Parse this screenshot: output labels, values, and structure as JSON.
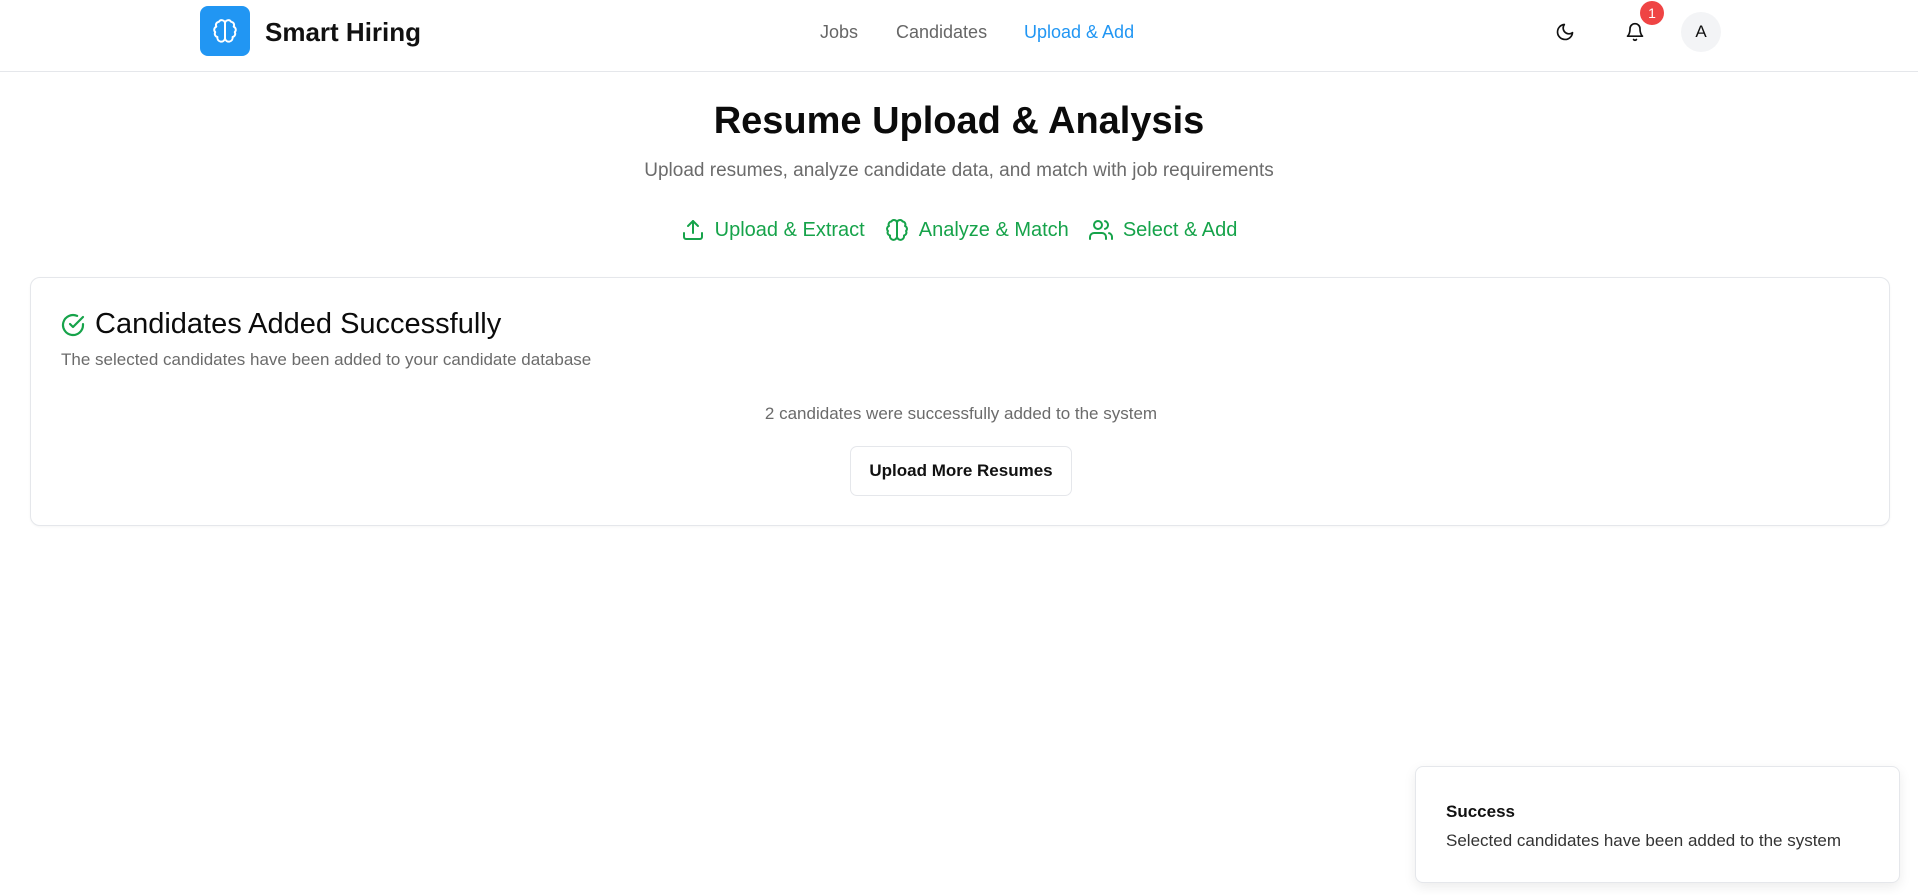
{
  "header": {
    "brand": "Smart Hiring",
    "nav": [
      {
        "label": "Jobs",
        "active": false
      },
      {
        "label": "Candidates",
        "active": false
      },
      {
        "label": "Upload & Add",
        "active": true
      }
    ],
    "notification_count": "1",
    "avatar_initial": "A",
    "icons": {
      "logo": "brain-icon",
      "theme": "moon-icon",
      "notifications": "bell-icon"
    }
  },
  "page": {
    "title": "Resume Upload & Analysis",
    "subtitle": "Upload resumes, analyze candidate data, and match with job requirements",
    "steps": [
      {
        "label": "Upload & Extract",
        "icon": "upload-icon"
      },
      {
        "label": "Analyze & Match",
        "icon": "brain-icon"
      },
      {
        "label": "Select & Add",
        "icon": "users-icon"
      }
    ]
  },
  "result_card": {
    "title": "Candidates Added Successfully",
    "description": "The selected candidates have been added to your candidate database",
    "message": "2 candidates were successfully added to the system",
    "button_label": "Upload More Resumes",
    "icon": "check-circle-icon"
  },
  "toast": {
    "title": "Success",
    "message": "Selected candidates have been added to the system"
  },
  "colors": {
    "accent_blue": "#2196f3",
    "success_green": "#16a34a",
    "badge_red": "#ef4444",
    "muted_text": "#6b6b6b",
    "border": "#e5e7eb"
  }
}
